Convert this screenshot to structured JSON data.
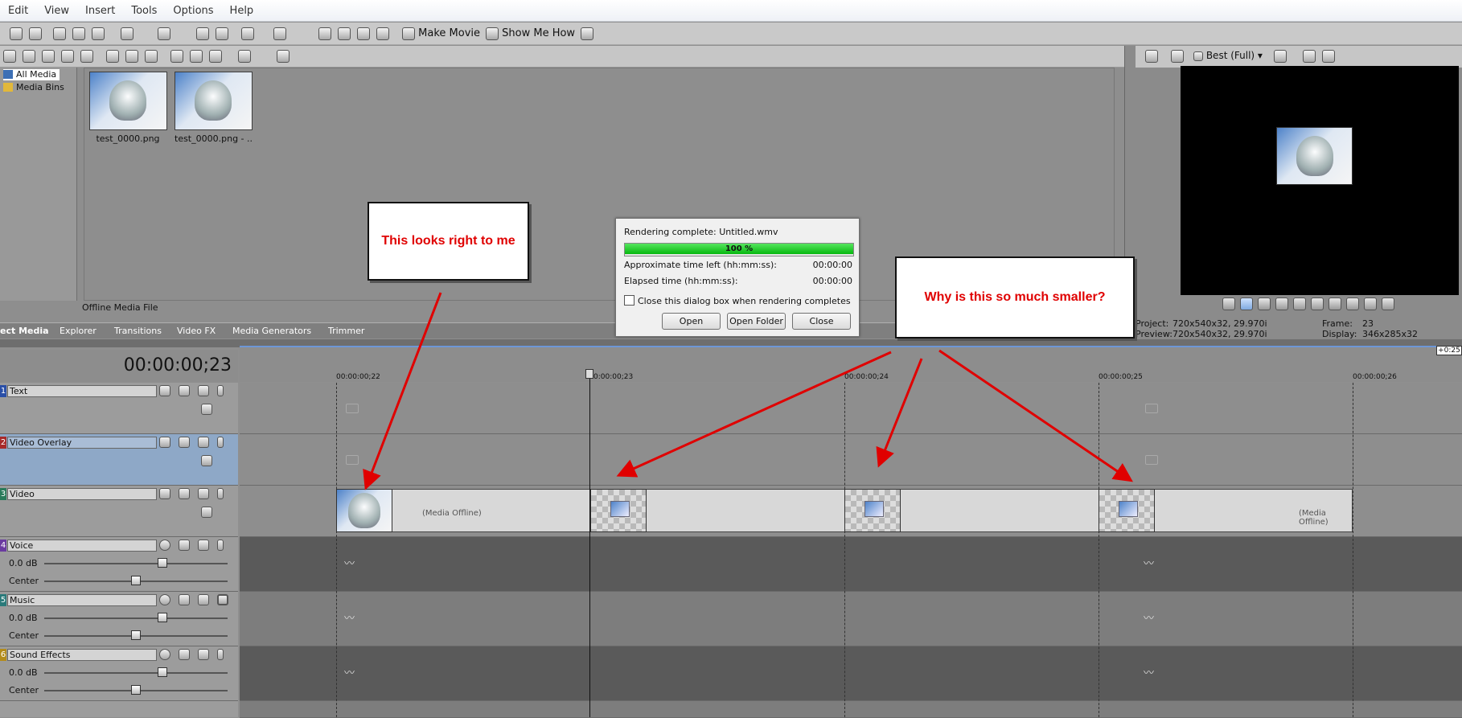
{
  "menu": [
    "Edit",
    "View",
    "Insert",
    "Tools",
    "Options",
    "Help"
  ],
  "toolbar": {
    "make_movie": "Make Movie",
    "show_me_how": "Show Me How"
  },
  "media_tree": {
    "all_media": "All Media",
    "media_bins": "Media Bins"
  },
  "media_items": [
    {
      "caption": "test_0000.png"
    },
    {
      "caption": "test_0000.png - ..."
    }
  ],
  "media_status": "Offline Media File",
  "tabs": [
    "ect Media",
    "Explorer",
    "Transitions",
    "Video FX",
    "Media Generators",
    "Trimmer"
  ],
  "preview": {
    "quality": "Best (Full)",
    "project_label": "Project:",
    "project_value": "720x540x32, 29.970i",
    "preview_label": "Preview:",
    "preview_value": "720x540x32, 29.970i",
    "frame_label": "Frame:",
    "frame_value": "23",
    "display_label": "Display:",
    "display_value": "346x285x32"
  },
  "timeline": {
    "timecode": "00:00:00;23",
    "zoom": "+0:25",
    "ruler": [
      "00:00:00;22",
      "0:00:00;23",
      "00:00:00;24",
      "00:00:00;25",
      "00:00:00;26"
    ]
  },
  "tracks": [
    {
      "num": "1",
      "name": "Text",
      "type": "video",
      "num_color": "#2a4fa7"
    },
    {
      "num": "2",
      "name": "Video Overlay",
      "type": "video",
      "num_color": "#a72a2a"
    },
    {
      "num": "3",
      "name": "Video",
      "type": "video",
      "num_color": "#2a7a5a"
    },
    {
      "num": "4",
      "name": "Voice",
      "type": "audio",
      "db": "0.0 dB",
      "pan": "Center",
      "num_color": "#6a3aa0"
    },
    {
      "num": "5",
      "name": "Music",
      "type": "audio",
      "db": "0.0 dB",
      "pan": "Center",
      "num_color": "#2a7a7a"
    },
    {
      "num": "6",
      "name": "Sound Effects",
      "type": "audio",
      "db": "0.0 dB",
      "pan": "Center",
      "num_color": "#b38b1a"
    }
  ],
  "clips": {
    "offline1": "(Media Offline)",
    "offline2": "(Media Offline)"
  },
  "dialog": {
    "title": "Rendering complete: Untitled.wmv",
    "progress": 100,
    "progress_label": "100 %",
    "time_left_label": "Approximate time left (hh:mm:ss):",
    "time_left": "00:00:00",
    "elapsed_label": "Elapsed time (hh:mm:ss):",
    "elapsed": "00:00:00",
    "checkbox": "Close this dialog box when rendering completes",
    "open": "Open",
    "open_folder": "Open Folder",
    "close": "Close"
  },
  "callouts": {
    "left": "This looks right to me",
    "right": "Why is this so much smaller?"
  },
  "colors": {
    "annotation": "#e00000",
    "progress": "#06b80f"
  }
}
